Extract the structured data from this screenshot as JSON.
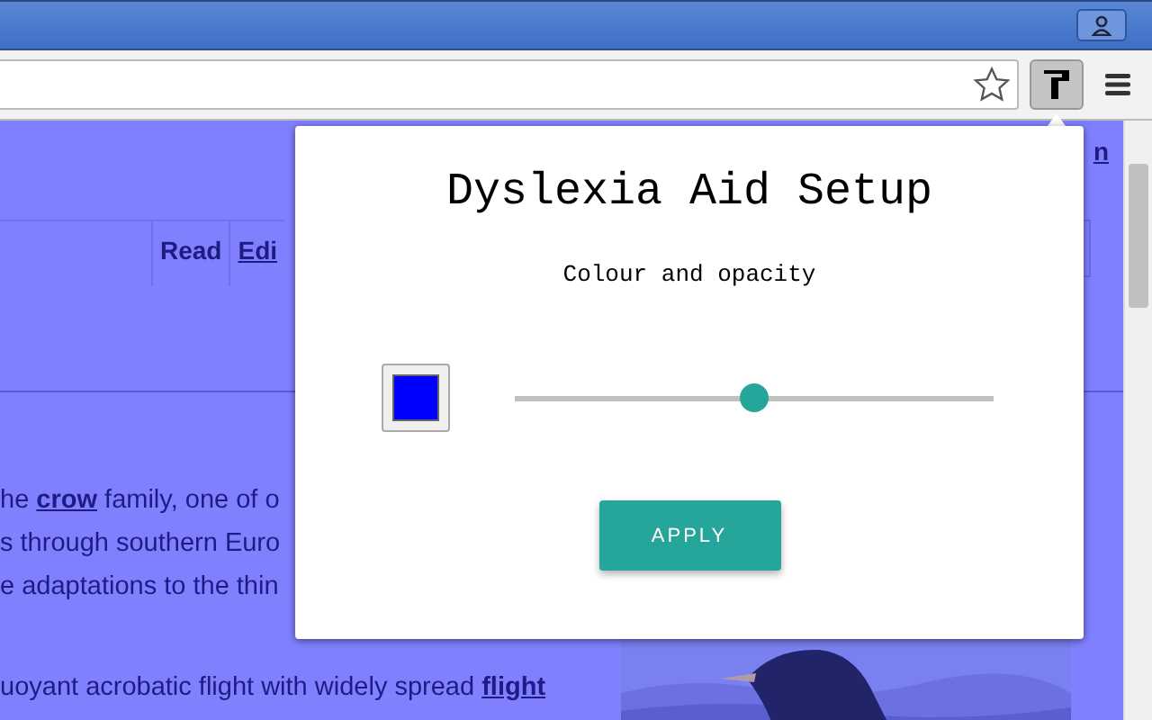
{
  "browser": {
    "extension_button": {
      "selected": true
    }
  },
  "page": {
    "corner_link": "n",
    "tabs": [
      {
        "label": "Read",
        "selected": true
      },
      {
        "label": "Edi",
        "selected": false
      }
    ],
    "lines": [
      "he **crow** family, one of o",
      "s through southern Euro",
      "e adaptations to the thin",
      "uoyant acrobatic flight with widely spread **flight**"
    ]
  },
  "popup": {
    "title": "Dyslexia Aid Setup",
    "subtitle": "Colour and opacity",
    "swatch": {
      "color": "#0000ff"
    },
    "opacity": {
      "level": 0.5
    },
    "button": "APPLY"
  }
}
